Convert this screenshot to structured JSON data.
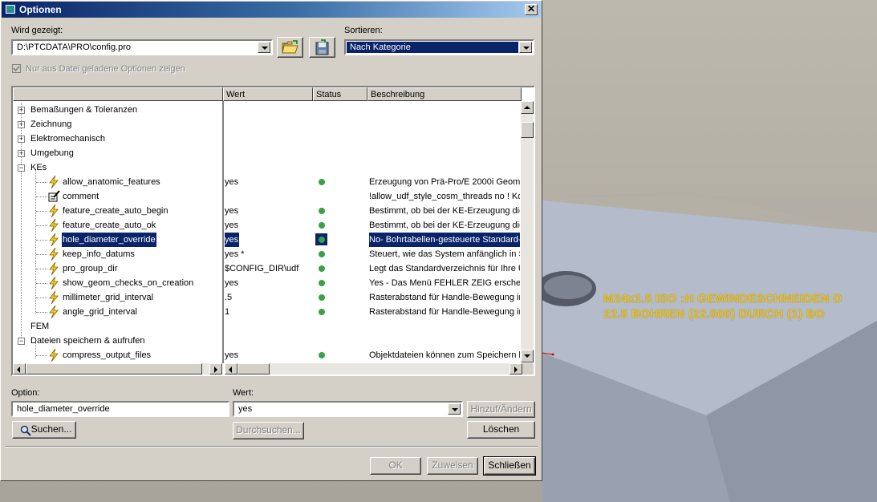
{
  "window": {
    "title": "Optionen"
  },
  "shown": {
    "label": "Wird gezeigt:",
    "value": "D:\\PTCDATA\\PRO\\config.pro"
  },
  "sort": {
    "label": "Sortieren:",
    "value": "Nach Kategorie"
  },
  "loaded_only": {
    "label": "Nur aus Datei geladene Optionen zeigen"
  },
  "columns": {
    "value": "Wert",
    "status": "Status",
    "description": "Beschreibung"
  },
  "tree": {
    "cat_dims": "Bemaßungen & Toleranzen",
    "cat_drawing": "Zeichnung",
    "cat_electromech": "Elektromechanisch",
    "cat_env": "Umgebung",
    "cat_features": "KEs",
    "cat_fem": "FEM",
    "cat_save": "Dateien speichern & aufrufen"
  },
  "options": [
    {
      "name": "allow_anatomic_features",
      "value": "yes",
      "desc": "Erzeugung von Prä-Pro/E 2000i Geome"
    },
    {
      "name": "comment",
      "value": "",
      "desc": "!allow_udf_style_cosm_threads no ! Kos"
    },
    {
      "name": "feature_create_auto_begin",
      "value": "yes",
      "desc": "Bestimmt, ob bei der KE-Erzeugung die S"
    },
    {
      "name": "feature_create_auto_ok",
      "value": "yes",
      "desc": "Bestimmt, ob bei der KE-Erzeugung die S"
    },
    {
      "name": "hole_diameter_override",
      "value": "yes",
      "desc": "No- Bohrtabellen-gesteuerte Standard-B"
    },
    {
      "name": "keep_info_datums",
      "value": "yes *",
      "desc": "Steuert, wie das System anfänglich in Si"
    },
    {
      "name": "pro_group_dir",
      "value": "$CONFIG_DIR\\udf",
      "desc": "Legt das Standardverzeichnis für Ihre UI"
    },
    {
      "name": "show_geom_checks_on_creation",
      "value": "yes",
      "desc": "Yes - Das Menü FEHLER ZEIG erschein"
    },
    {
      "name": "millimeter_grid_interval",
      "value": ".5",
      "desc": "Rasterabstand für Handle-Bewegung in"
    },
    {
      "name": "angle_grid_interval",
      "value": "1",
      "desc": "Rasterabstand für Handle-Bewegung in"
    }
  ],
  "save_options": [
    {
      "name": "compress_output_files",
      "value": "yes",
      "desc": "Objektdateien können zum Speichern k"
    }
  ],
  "option_field": {
    "label": "Option:",
    "value": "hole_diameter_override"
  },
  "value_field": {
    "label": "Wert:",
    "value": "yes"
  },
  "buttons": {
    "add_change": "Hinzuf/Ändern",
    "search": "Suchen...",
    "browse": "Durchsuchen...",
    "delete": "Löschen",
    "ok": "OK",
    "apply": "Zuweisen",
    "close": "Schließen"
  },
  "cad_annotation": {
    "line1": "M24x1.5 ISO  :H GEWINDESCHNEIDEN  D",
    "line2": "22.5 BOHREN (22.500)  DURCH  (1) BO"
  },
  "colors": {
    "status_ok": "#3aa04a",
    "selection": "#0a246a",
    "annotation": "#e8c020"
  }
}
